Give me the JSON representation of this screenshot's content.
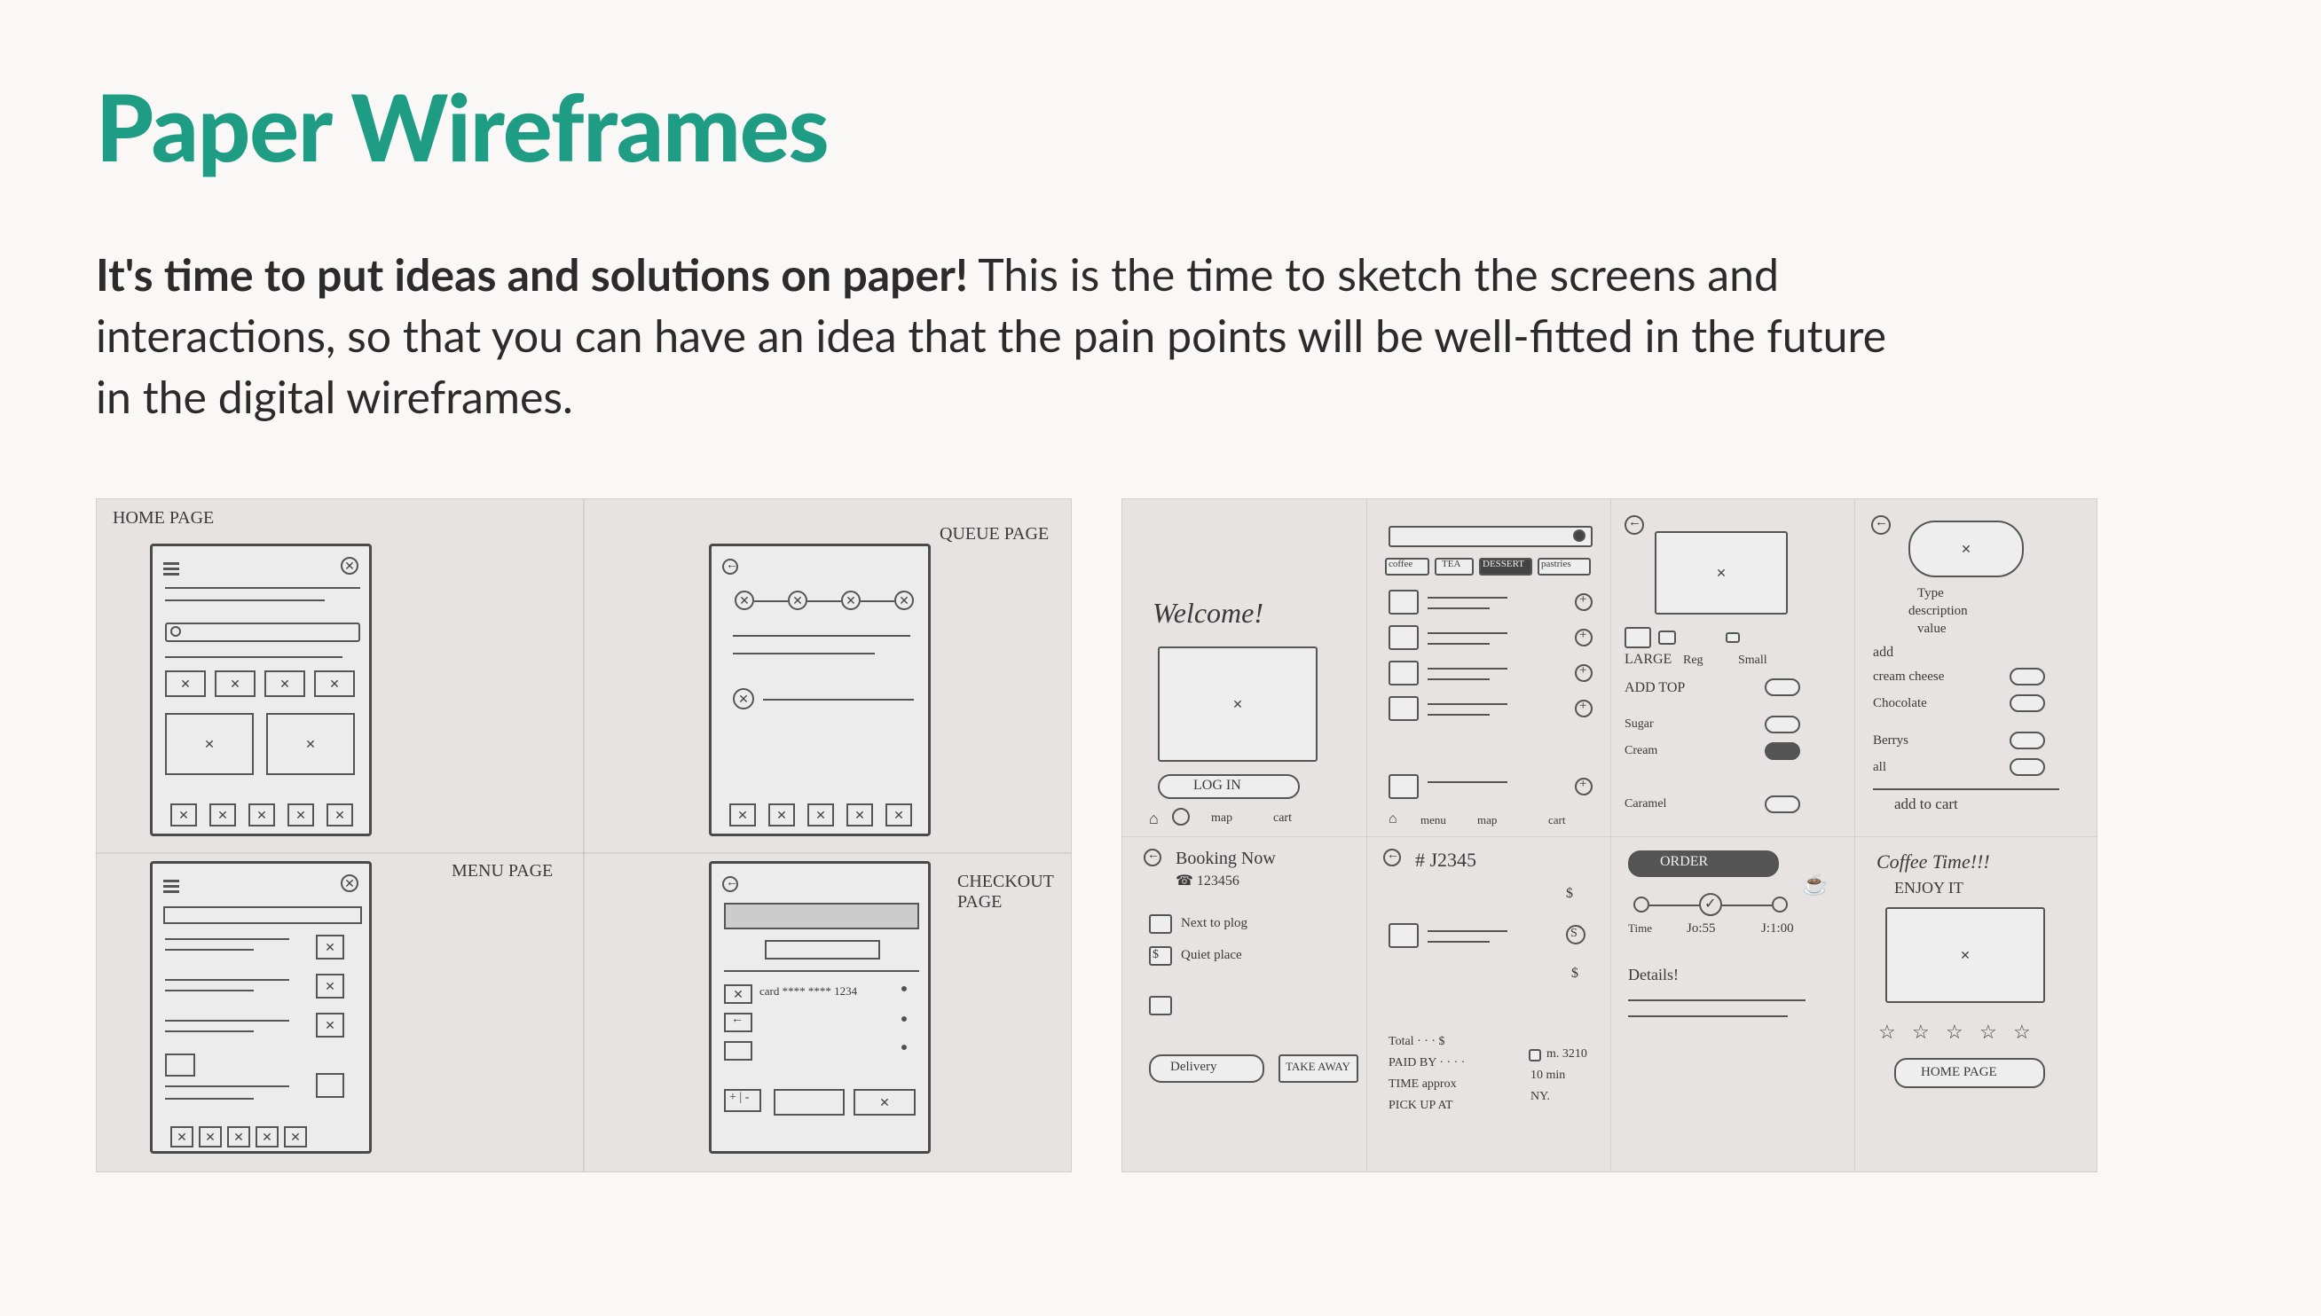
{
  "title": "Paper Wireframes",
  "body": {
    "bold": "It's time to put ideas and solutions on paper!",
    "rest": " This is the time to sketch the screens and interactions, so that you can have an idea that the pain points will be well-fitted in the future in the digital wireframes."
  },
  "left_photo": {
    "labels": {
      "home": "HOME PAGE",
      "queue": "QUEUE PAGE",
      "menu": "MENU PAGE",
      "checkout": "CHECKOUT PAGE"
    },
    "checkout": {
      "card": "card **** **** 1234"
    }
  },
  "right_photo": {
    "col1": {
      "welcome": "Welcome!",
      "login": "LOG IN",
      "nav_map": "map",
      "nav_cart": "cart",
      "booking": "Booking Now",
      "phone": "☎ 123456",
      "next_to_plog": "Next to plog",
      "quiet": "Quiet place",
      "delivery": "Delivery",
      "takeaway": "TAKE AWAY",
      "home_icon": "⌂",
      "menu_nav": "menu"
    },
    "col2": {
      "tabs": [
        "coffee",
        "TEA",
        "DESSERT",
        "pastries"
      ],
      "order_num": "# J2345",
      "total": "Total  ·  ·  ·  $",
      "paid_by": "PAID BY  · · ·  ·",
      "time": "TIME approx",
      "pickup": "PICK UP AT",
      "nav_menu": "menu",
      "nav_map": "map",
      "nav_cart": "cart",
      "s": "S",
      "dollar": "$",
      "dollar2": "$",
      "m": "m. 3210",
      "min": "10 min",
      "ny": "NY."
    },
    "col3": {
      "large": "LARGE",
      "reg": "Reg",
      "small": "Small",
      "add_top": "ADD TOP",
      "sugar": "Sugar",
      "cream": "Cream",
      "caramel": "Caramel",
      "order": "ORDER",
      "joss": "Jo:55",
      "time": "Time",
      "end_time": "J:1:00",
      "details": "Details!"
    },
    "col4": {
      "type": "Type",
      "desc": "description",
      "value": "value",
      "add": "add",
      "cream_cheese": "cream cheese",
      "chocolate": "Chocolate",
      "berrys": "Berrys",
      "all": "all",
      "add_cart": "add to cart",
      "coffee_time": "Coffee Time!!!",
      "enjoy": "ENJOY IT",
      "home_page": "HOME PAGE"
    }
  }
}
